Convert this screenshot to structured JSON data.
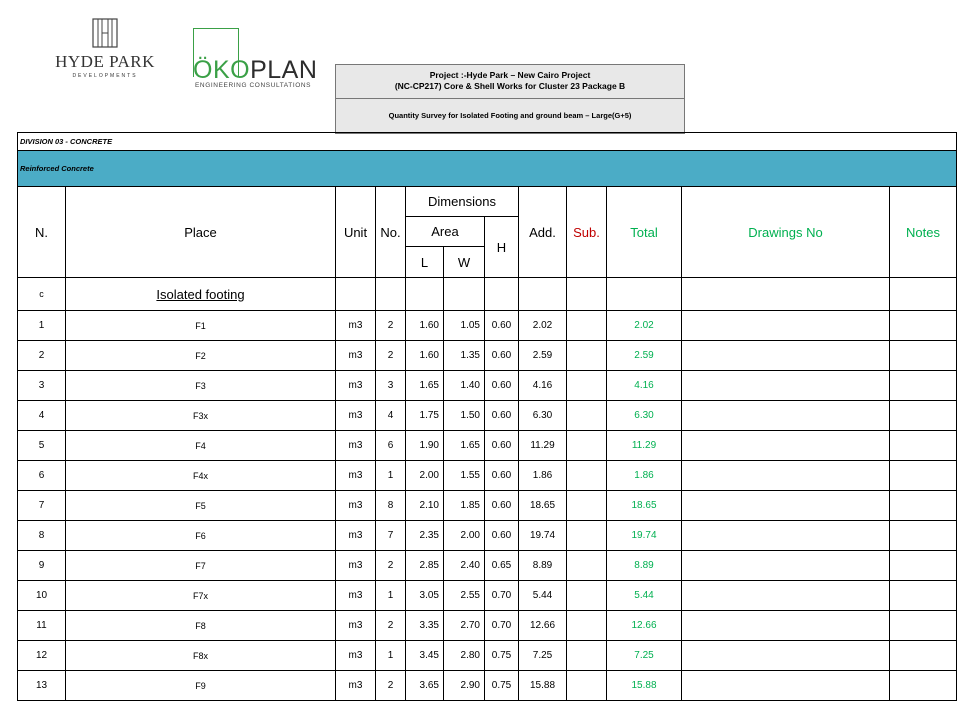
{
  "logos": {
    "hyde_park": {
      "name": "HYDE PARK",
      "sub": "DEVELOPMENTS"
    },
    "okoplan": {
      "oko": "ÖKO",
      "plan": "PLAN",
      "sub": "ENGINEERING CONSULTATIONS"
    }
  },
  "title": {
    "line1": "Project :-Hyde Park – New Cairo Project",
    "line2": "(NC-CP217) Core & Shell Works for Cluster 23 Package B",
    "subtitle": "Quantity Survey for Isolated Footing and ground beam – Large(G+5)"
  },
  "division": "DIVISION 03 - CONCRETE",
  "category": "Reinforced Concrete",
  "headers": {
    "n": "N.",
    "place": "Place",
    "unit": "Unit",
    "no": "No.",
    "dimensions": "Dimensions",
    "area": "Area",
    "l": "L",
    "w": "W",
    "h": "H",
    "add": "Add.",
    "sub": "Sub.",
    "total": "Total",
    "drawings": "Drawings No",
    "notes": "Notes"
  },
  "section": {
    "code": "c",
    "title": "Isolated footing"
  },
  "rows": [
    {
      "n": "1",
      "place": "F1",
      "unit": "m3",
      "no": "2",
      "l": "1.60",
      "w": "1.05",
      "h": "0.60",
      "add": "2.02",
      "total": "2.02"
    },
    {
      "n": "2",
      "place": "F2",
      "unit": "m3",
      "no": "2",
      "l": "1.60",
      "w": "1.35",
      "h": "0.60",
      "add": "2.59",
      "total": "2.59"
    },
    {
      "n": "3",
      "place": "F3",
      "unit": "m3",
      "no": "3",
      "l": "1.65",
      "w": "1.40",
      "h": "0.60",
      "add": "4.16",
      "total": "4.16"
    },
    {
      "n": "4",
      "place": "F3x",
      "unit": "m3",
      "no": "4",
      "l": "1.75",
      "w": "1.50",
      "h": "0.60",
      "add": "6.30",
      "total": "6.30"
    },
    {
      "n": "5",
      "place": "F4",
      "unit": "m3",
      "no": "6",
      "l": "1.90",
      "w": "1.65",
      "h": "0.60",
      "add": "11.29",
      "total": "11.29"
    },
    {
      "n": "6",
      "place": "F4x",
      "unit": "m3",
      "no": "1",
      "l": "2.00",
      "w": "1.55",
      "h": "0.60",
      "add": "1.86",
      "total": "1.86"
    },
    {
      "n": "7",
      "place": "F5",
      "unit": "m3",
      "no": "8",
      "l": "2.10",
      "w": "1.85",
      "h": "0.60",
      "add": "18.65",
      "total": "18.65"
    },
    {
      "n": "8",
      "place": "F6",
      "unit": "m3",
      "no": "7",
      "l": "2.35",
      "w": "2.00",
      "h": "0.60",
      "add": "19.74",
      "total": "19.74"
    },
    {
      "n": "9",
      "place": "F7",
      "unit": "m3",
      "no": "2",
      "l": "2.85",
      "w": "2.40",
      "h": "0.65",
      "add": "8.89",
      "total": "8.89"
    },
    {
      "n": "10",
      "place": "F7x",
      "unit": "m3",
      "no": "1",
      "l": "3.05",
      "w": "2.55",
      "h": "0.70",
      "add": "5.44",
      "total": "5.44"
    },
    {
      "n": "11",
      "place": "F8",
      "unit": "m3",
      "no": "2",
      "l": "3.35",
      "w": "2.70",
      "h": "0.70",
      "add": "12.66",
      "total": "12.66"
    },
    {
      "n": "12",
      "place": "F8x",
      "unit": "m3",
      "no": "1",
      "l": "3.45",
      "w": "2.80",
      "h": "0.75",
      "add": "7.25",
      "total": "7.25"
    },
    {
      "n": "13",
      "place": "F9",
      "unit": "m3",
      "no": "2",
      "l": "3.65",
      "w": "2.90",
      "h": "0.75",
      "add": "15.88",
      "total": "15.88"
    }
  ],
  "colors": {
    "band": "#4bacc6",
    "total_green": "#00b050",
    "sub_red": "#c00000",
    "oko_green": "#3aa046"
  }
}
